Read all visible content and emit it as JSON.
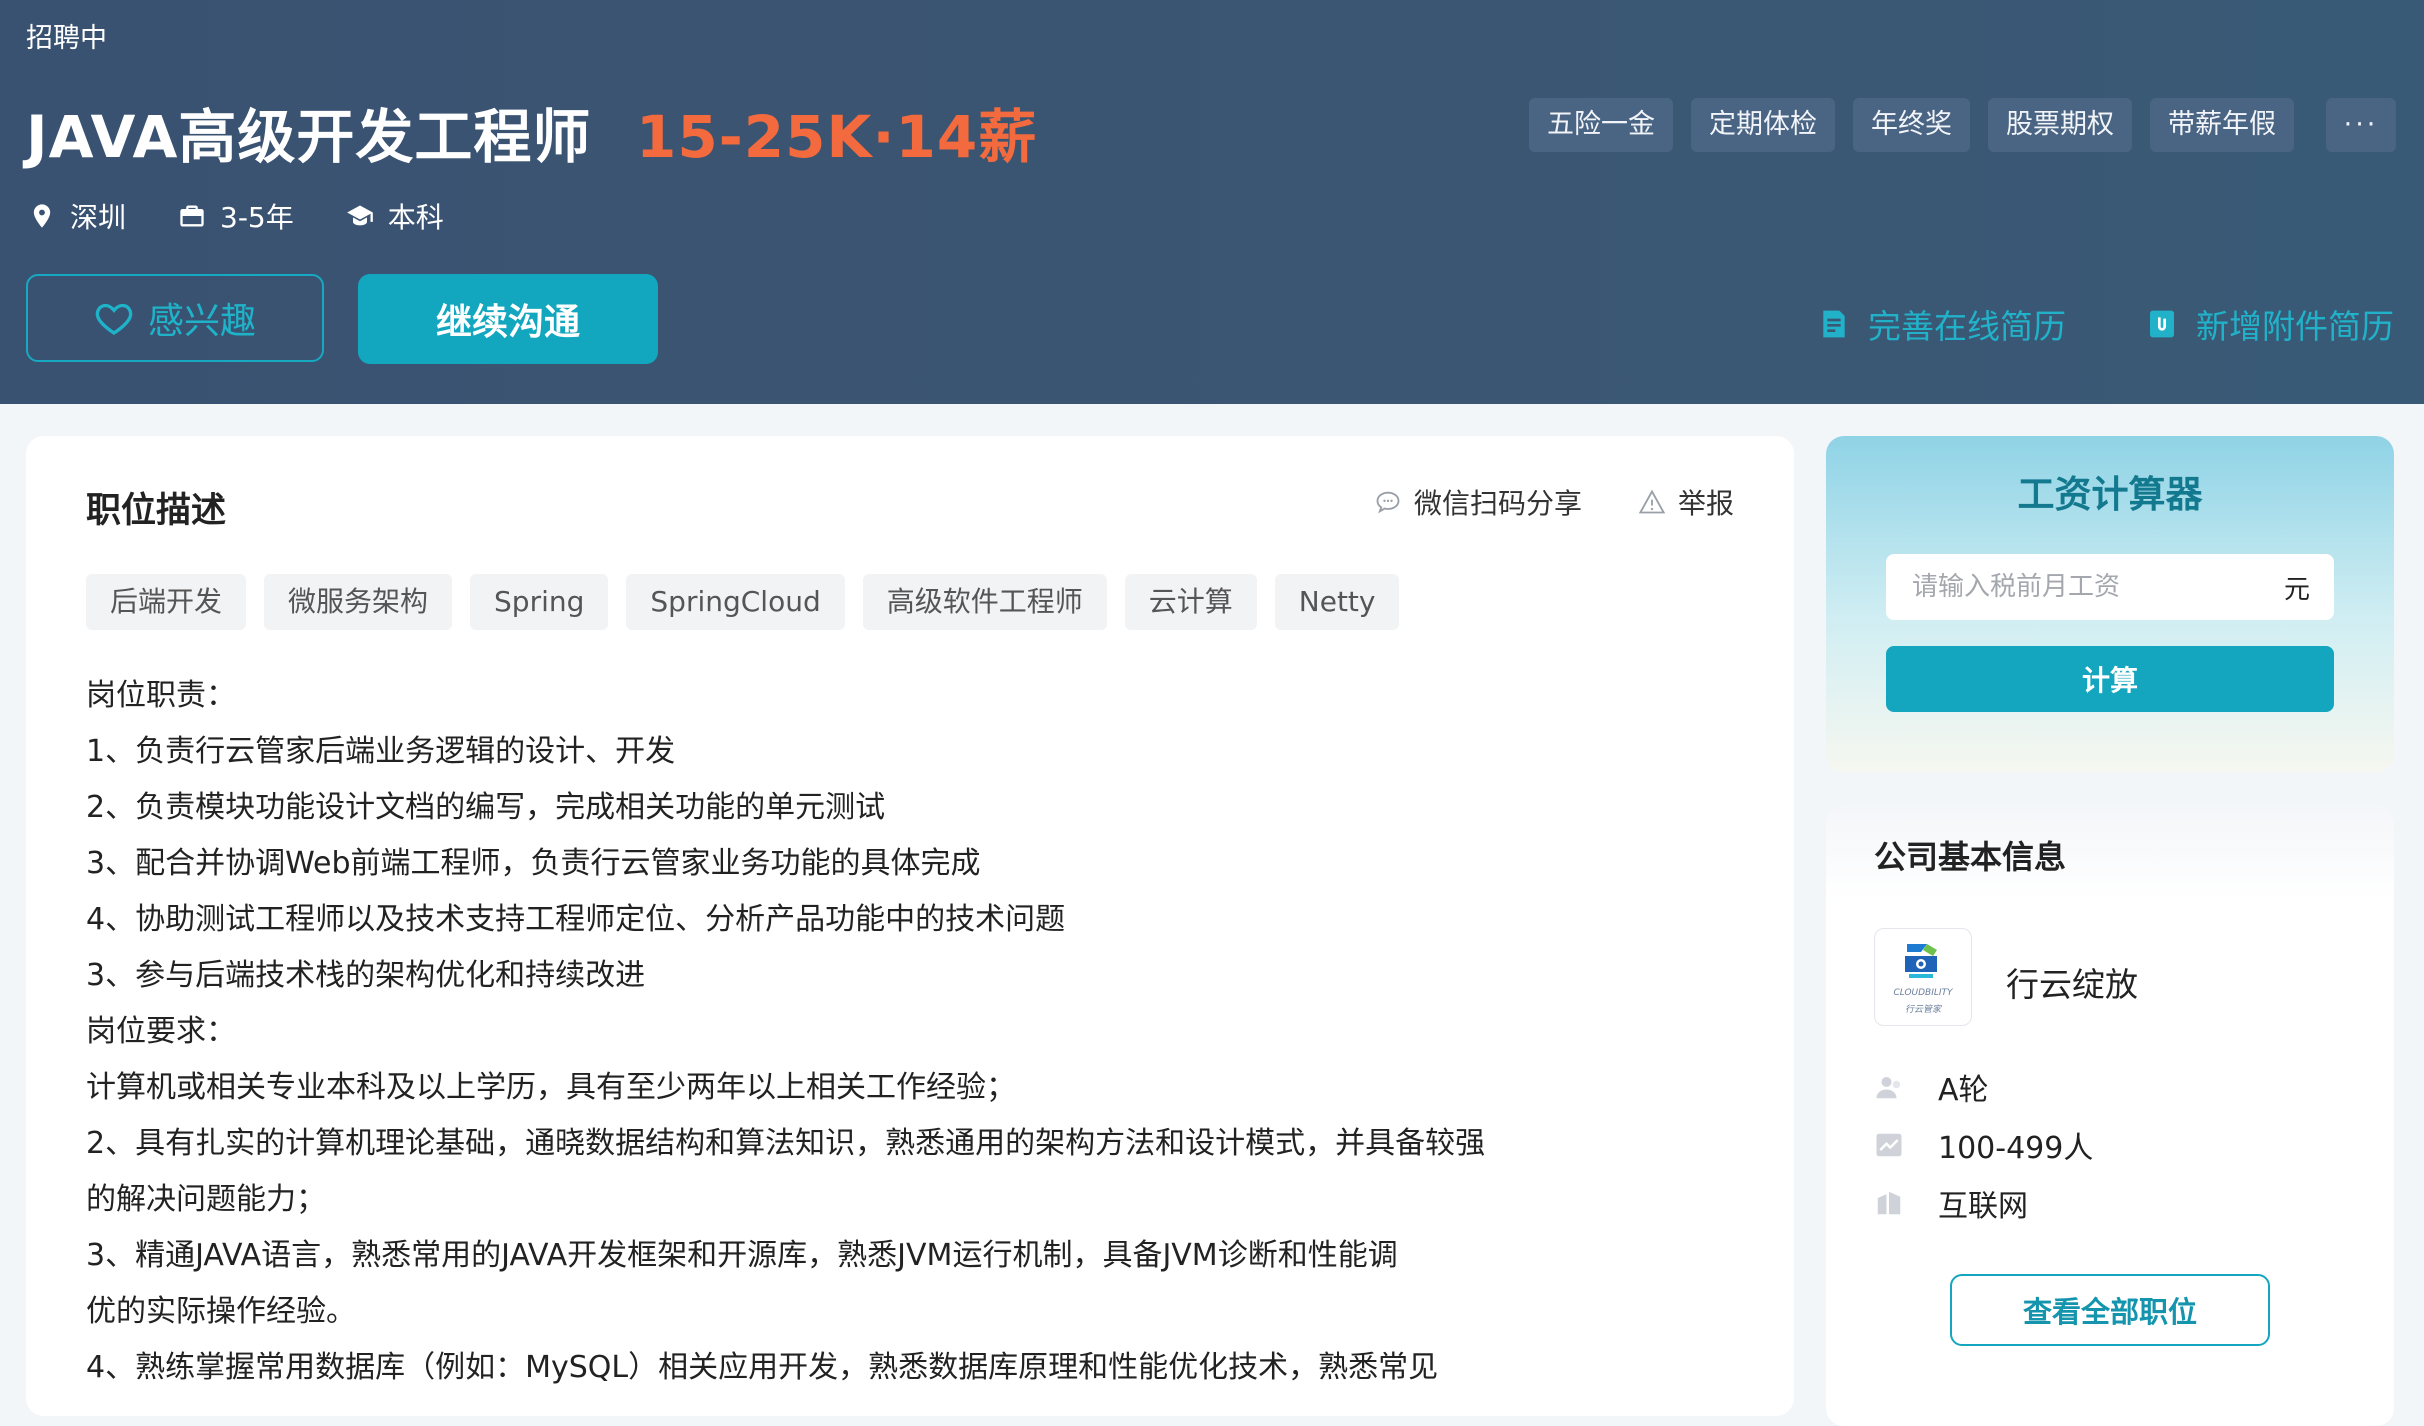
{
  "header": {
    "status": "招聘中",
    "title": "JAVA高级开发工程师",
    "salary": "15-25K·14薪",
    "meta": {
      "city": "深圳",
      "experience": "3-5年",
      "education": "本科"
    },
    "benefits": [
      "五险一金",
      "定期体检",
      "年终奖",
      "股票期权",
      "带薪年假"
    ],
    "benefits_more": "···",
    "interest_label": "感兴趣",
    "chat_label": "继续沟通",
    "improve_resume_label": "完善在线简历",
    "add_attachment_label": "新增附件简历"
  },
  "main": {
    "section_title": "职位描述",
    "share_label": "微信扫码分享",
    "report_label": "举报",
    "tags": [
      "后端开发",
      "微服务架构",
      "Spring",
      "SpringCloud",
      "高级软件工程师",
      "云计算",
      "Netty"
    ],
    "description": [
      "岗位职责：",
      "1、负责行云管家后端业务逻辑的设计、开发",
      "2、负责模块功能设计文档的编写，完成相关功能的单元测试",
      "3、配合并协调Web前端工程师，负责行云管家业务功能的具体完成",
      "4、协助测试工程师以及技术支持工程师定位、分析产品功能中的技术问题",
      "3、参与后端技术栈的架构优化和持续改进",
      "岗位要求：",
      "计算机或相关专业本科及以上学历，具有至少两年以上相关工作经验；",
      "2、具有扎实的计算机理论基础，通晓数据结构和算法知识，熟悉通用的架构方法和设计模式，并具备较强",
      "的解决问题能力；",
      "3、精通JAVA语言，熟悉常用的JAVA开发框架和开源库，熟悉JVM运行机制，具备JVM诊断和性能调",
      "优的实际操作经验。",
      "4、熟练掌握常用数据库（例如：MySQL）相关应用开发，熟悉数据库原理和性能优化技术，熟悉常见"
    ]
  },
  "calculator": {
    "title": "工资计算器",
    "input_placeholder": "请输入税前月工资",
    "unit": "元",
    "button_label": "计算"
  },
  "company": {
    "section_title": "公司基本信息",
    "name": "行云绽放",
    "logo_text": "CLOUDBILITY",
    "logo_subtext": "行云管家",
    "funding": "A轮",
    "size": "100-499人",
    "industry": "互联网",
    "all_jobs_label": "查看全部职位"
  },
  "colors": {
    "header_bg": "#3a5673",
    "salary": "#f26a3d",
    "accent": "#14a6bf"
  }
}
